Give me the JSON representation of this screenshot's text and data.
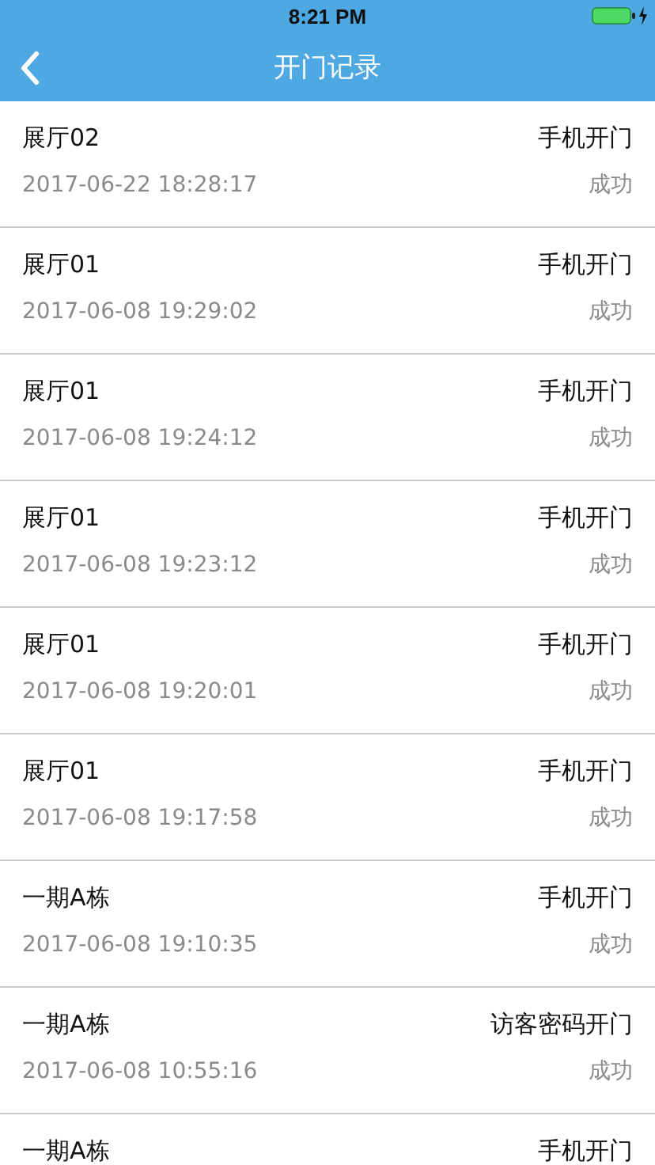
{
  "status_bar": {
    "time": "8:21 PM"
  },
  "nav_bar": {
    "title": "开门记录"
  },
  "records": [
    {
      "place": "展厅02",
      "method": "手机开门",
      "time": "2017-06-22 18:28:17",
      "result": "成功"
    },
    {
      "place": "展厅01",
      "method": "手机开门",
      "time": "2017-06-08 19:29:02",
      "result": "成功"
    },
    {
      "place": "展厅01",
      "method": "手机开门",
      "time": "2017-06-08 19:24:12",
      "result": "成功"
    },
    {
      "place": "展厅01",
      "method": "手机开门",
      "time": "2017-06-08 19:23:12",
      "result": "成功"
    },
    {
      "place": "展厅01",
      "method": "手机开门",
      "time": "2017-06-08 19:20:01",
      "result": "成功"
    },
    {
      "place": "展厅01",
      "method": "手机开门",
      "time": "2017-06-08 19:17:58",
      "result": "成功"
    },
    {
      "place": "一期A栋",
      "method": "手机开门",
      "time": "2017-06-08 19:10:35",
      "result": "成功"
    },
    {
      "place": "一期A栋",
      "method": "访客密码开门",
      "time": "2017-06-08 10:55:16",
      "result": "成功"
    },
    {
      "place": "一期A栋",
      "method": "手机开门"
    }
  ]
}
